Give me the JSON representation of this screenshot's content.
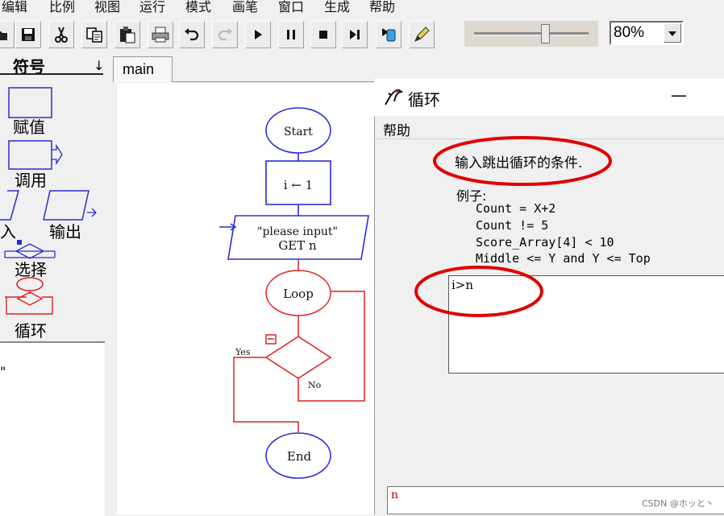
{
  "menubar": {
    "items": [
      "编辑",
      "比例",
      "视图",
      "运行",
      "模式",
      "画笔",
      "窗口",
      "生成",
      "帮助"
    ]
  },
  "toolbar": {
    "buttons": [
      "open-icon",
      "save-icon",
      "cut-icon",
      "copy-icon",
      "paste-icon",
      "print-icon",
      "undo-icon",
      "redo-icon",
      "play-icon",
      "pause-icon",
      "stop-icon",
      "step-icon",
      "stepinto-icon",
      "pen-icon"
    ],
    "zoom": {
      "value": "80%"
    },
    "speed_slider": {
      "level": 0.62
    }
  },
  "symbols": {
    "title": "符号",
    "arrow": "↓",
    "items": {
      "assign": "赋值",
      "call": "调用",
      "input": "入",
      "output": "输出",
      "select": "选择",
      "loop": "循环"
    }
  },
  "variables": {
    "partial": "\""
  },
  "tabs": [
    {
      "label": "main"
    }
  ],
  "flowchart": {
    "start": "Start",
    "assign": "i ← 1",
    "input_line1": "\"please input\"",
    "input_line2": "GET n",
    "loop": "Loop",
    "yes": "Yes",
    "no": "No",
    "end": "End"
  },
  "dialog": {
    "title": "循环",
    "minimize": "—",
    "menu": "帮助",
    "instruction": "输入跳出循环的条件.",
    "example_label": "例子:",
    "examples": [
      "Count = X+2",
      "Count != 5",
      "Score_Array[4] < 10",
      "Middle <= Y and Y <= Top"
    ],
    "condition_value": "i>n",
    "bottom_text": "n"
  },
  "watermark": "CSDN @ホッと丶",
  "colors": {
    "flow_blue": "#2b2bd9",
    "loop_red": "#e02020",
    "annotation_red": "#e00000"
  }
}
